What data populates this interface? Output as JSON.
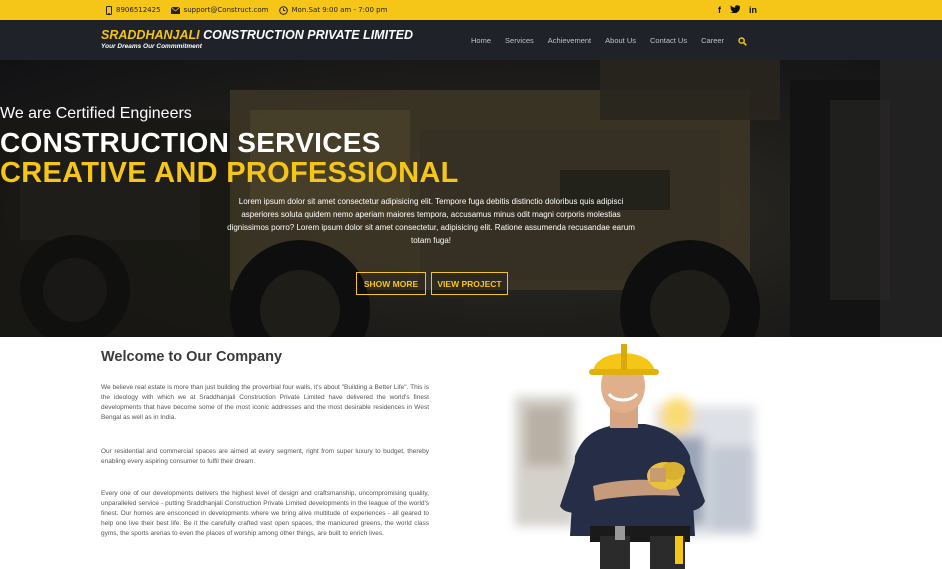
{
  "topbar": {
    "phone": "8906512425",
    "email": "support@Construct.com",
    "hours": "Mon.Sat 9:00 am - 7:00 pm",
    "social": [
      "f",
      "t",
      "in"
    ]
  },
  "header": {
    "brand_highlight": "SRADDHANJALI",
    "brand_rest": " CONSTRUCTION PRIVATE LIMITED",
    "tagline": "Your Dreams Our Commmitment",
    "nav": [
      "Home",
      "Services",
      "Achievement",
      "About Us",
      "Contact Us",
      "Career"
    ]
  },
  "hero": {
    "subtitle": "We are Certified Engineers",
    "title_line1": "CONSTRUCTION SERVICES",
    "title_line2": "CREATIVE AND PROFESSIONAL",
    "description": "Lorem ipsum dolor sit amet consectetur adipisicing elit. Tempore fuga debitis distinctio doloribus quis adipisci asperiores soluta quidem nemo aperiam maiores tempora, accusamus minus odit magni corporis molestias dignissimos porro? Lorem ipsum dolor sit amet consectetur, adipisicing elit. Ratione assumenda recusandae earum totam fuga!",
    "btn_show": "SHOW MORE",
    "btn_view": "VIEW PROJECT"
  },
  "about": {
    "title": "Welcome to Our Company",
    "p1": "We believe real estate is more than just building the proverbial four walls, it's about \"Building a Better Life\". This is the ideology with which we at Sraddhanjali Construction Private Limited have delivered the world's finest developments that have become some of the most iconic addresses and the most desirable residences in West Bengal as well as in India.",
    "p2": "Our residential and commercial spaces are aimed at every segment, right from super luxury to budget, thereby enabling every aspiring consumer to fulfil their dream.",
    "p3": "Every one of our developments delivers the highest level of design and craftsmanship, uncompromising quality, unparalleled service - putting Sraddhanjali Construction Private Limited developments in the league of the world's finest. Our homes are ensconced in developments where we bring alive multitude of experiences - all geared to help one live their best life. Be it the carefully crafted vast open spaces, the manicured greens, the world class gyms, the sports arenas to even the places of worship among other things, are built to enrich lives."
  },
  "colors": {
    "accent": "#f5c518",
    "header_bg": "#1f2229"
  }
}
